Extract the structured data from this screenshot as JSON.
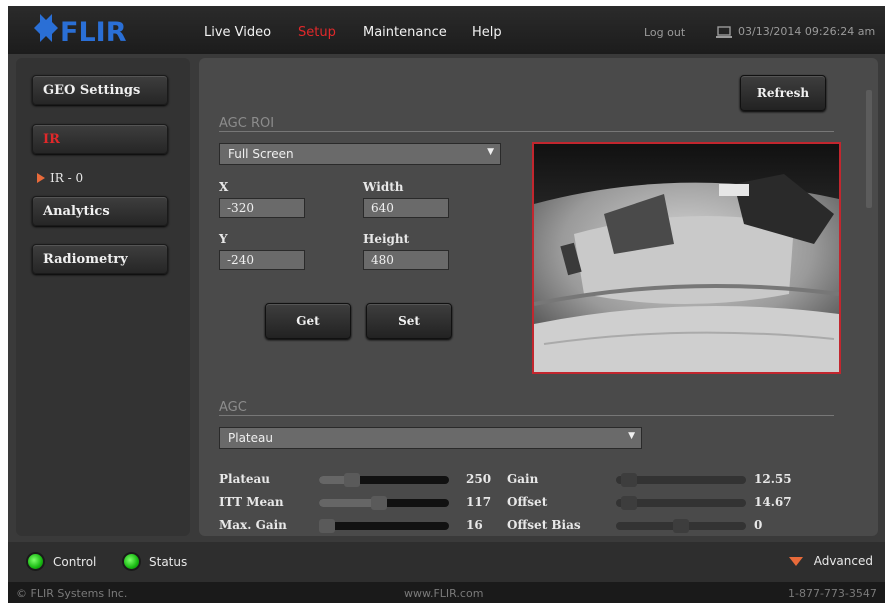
{
  "header": {
    "logo_text": "FLIR",
    "nav": [
      {
        "label": "Live Video",
        "active": false
      },
      {
        "label": "Setup",
        "active": true
      },
      {
        "label": "Maintenance",
        "active": false
      },
      {
        "label": "Help",
        "active": false
      }
    ],
    "logout": "Log out",
    "datetime": "03/13/2014 09:26:24 am"
  },
  "sidebar": {
    "items": [
      {
        "label": "GEO Settings"
      },
      {
        "label": "IR"
      },
      {
        "label": "Analytics"
      },
      {
        "label": "Radiometry"
      }
    ],
    "sub_item": "IR - 0"
  },
  "main": {
    "refresh_label": "Refresh",
    "agc_roi_title": "AGC ROI",
    "roi_mode": "Full Screen",
    "x_label": "X",
    "x_value": "-320",
    "width_label": "Width",
    "width_value": "640",
    "y_label": "Y",
    "y_value": "-240",
    "height_label": "Height",
    "height_value": "480",
    "get_label": "Get",
    "set_label": "Set",
    "agc_title": "AGC",
    "agc_mode": "Plateau",
    "params_left": [
      {
        "label": "Plateau",
        "value": "250",
        "fraction": 0.25
      },
      {
        "label": "ITT Mean",
        "value": "117",
        "fraction": 0.46
      },
      {
        "label": "Max. Gain",
        "value": "16",
        "fraction": 0.05
      }
    ],
    "params_right": [
      {
        "label": "Gain",
        "value": "12.55",
        "fraction": 0.1
      },
      {
        "label": "Offset",
        "value": "14.67",
        "fraction": 0.1
      },
      {
        "label": "Offset Bias",
        "value": "0",
        "fraction": 0.5
      }
    ]
  },
  "statusbar": {
    "control": "Control",
    "status": "Status",
    "advanced": "Advanced"
  },
  "footer": {
    "company": "© FLIR Systems Inc.",
    "website": "www.FLIR.com",
    "phone": "1-877-773-3547"
  },
  "colors": {
    "accent": "#e0282a",
    "logo_blue": "#2a6fd6",
    "led_green": "#17b811",
    "video_border": "#c2262e"
  }
}
